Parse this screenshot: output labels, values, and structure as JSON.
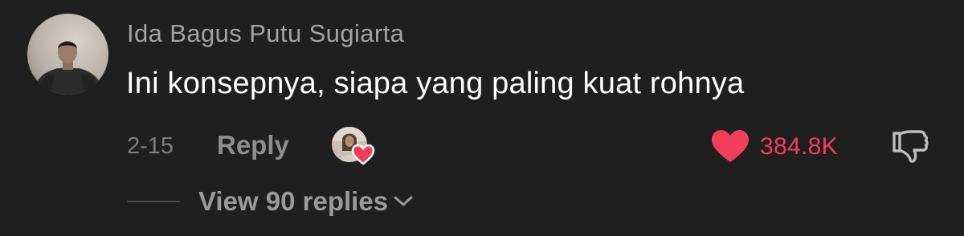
{
  "comment": {
    "username": "Ida Bagus Putu Sugiarta",
    "text": "Ini konsepnya, siapa yang paling kuat rohnya",
    "date": "2-15",
    "reply_label": "Reply",
    "like_count": "384.8K",
    "view_replies_label": "View 90 replies"
  },
  "colors": {
    "background": "#1f1f1f",
    "like_red": "#f13e5a",
    "secondary_text": "#a3a3a3"
  },
  "icons": {
    "like": "heart-icon",
    "dislike": "thumbs-down-icon",
    "expand": "chevron-down-icon",
    "creator_liked": "creator-liked-heart-icon"
  }
}
